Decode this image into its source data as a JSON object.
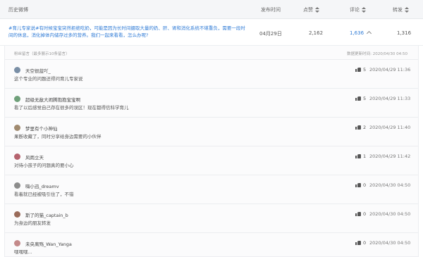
{
  "table": {
    "headers": {
      "history": "历史微博",
      "publish_time": "发布时间",
      "likes": "点赞",
      "comments": "评论",
      "reposts": "转发"
    }
  },
  "post": {
    "text": "#育儿专家说#有时候宝宝突然拒绝吃奶，可能是因为长时间摄取大量的奶、肝、肾和消化系统不堪重负，需要一段时间的休息，消化掉体内储存过多的营养。我们一起来看看，怎么办呢?",
    "date": "04月29日",
    "likes": "2,162",
    "comments": "1,636",
    "reposts": "1,316"
  },
  "comments_panel": {
    "header_left": "粉丝留言（最多展示10条留言）",
    "header_right": "数据更新时间: 2020/04/30 04:50",
    "items": [
      {
        "user": "天空很蓝吖_",
        "text": "这个专业的问题还得问育儿专家说",
        "likes": "5",
        "time": "2020/04/29 11:36",
        "avatar_color": "#7a8fa6"
      },
      {
        "user": "超级无敌大闹腾抱抱宝宝啊",
        "text": "看了以后感觉自己存在很多的误区！现在都得信科学育儿",
        "likes": "5",
        "time": "2020/04/29 11:33",
        "avatar_color": "#6fa07a"
      },
      {
        "user": "梦里有个小神仙",
        "text": "果断收藏了，同时分享给身边需要的小伙伴",
        "likes": "2",
        "time": "2020/04/29 11:40",
        "avatar_color": "#a08a6f"
      },
      {
        "user": "风雨立天",
        "text": "对待小孩子的问题真的要小心",
        "likes": "1",
        "time": "2020/04/29 11:42",
        "avatar_color": "#b5636e"
      },
      {
        "user": "嗨小迅_dreamv",
        "text": "看着就已经被吸引住了，不错",
        "likes": "0",
        "time": "2020/04/30 04:50",
        "avatar_color": "#8c8c8c"
      },
      {
        "user": "斯了的猫_captain_b",
        "text": "为身边的朋友转发",
        "likes": "0",
        "time": "2020/04/30 04:50",
        "avatar_color": "#9a6b5a"
      },
      {
        "user": "未央离殇_Wan_Yanga",
        "text": "嘿嘿嘿...",
        "likes": "0",
        "time": "2020/04/30 04:50",
        "avatar_color": "#c48a8a"
      }
    ]
  }
}
